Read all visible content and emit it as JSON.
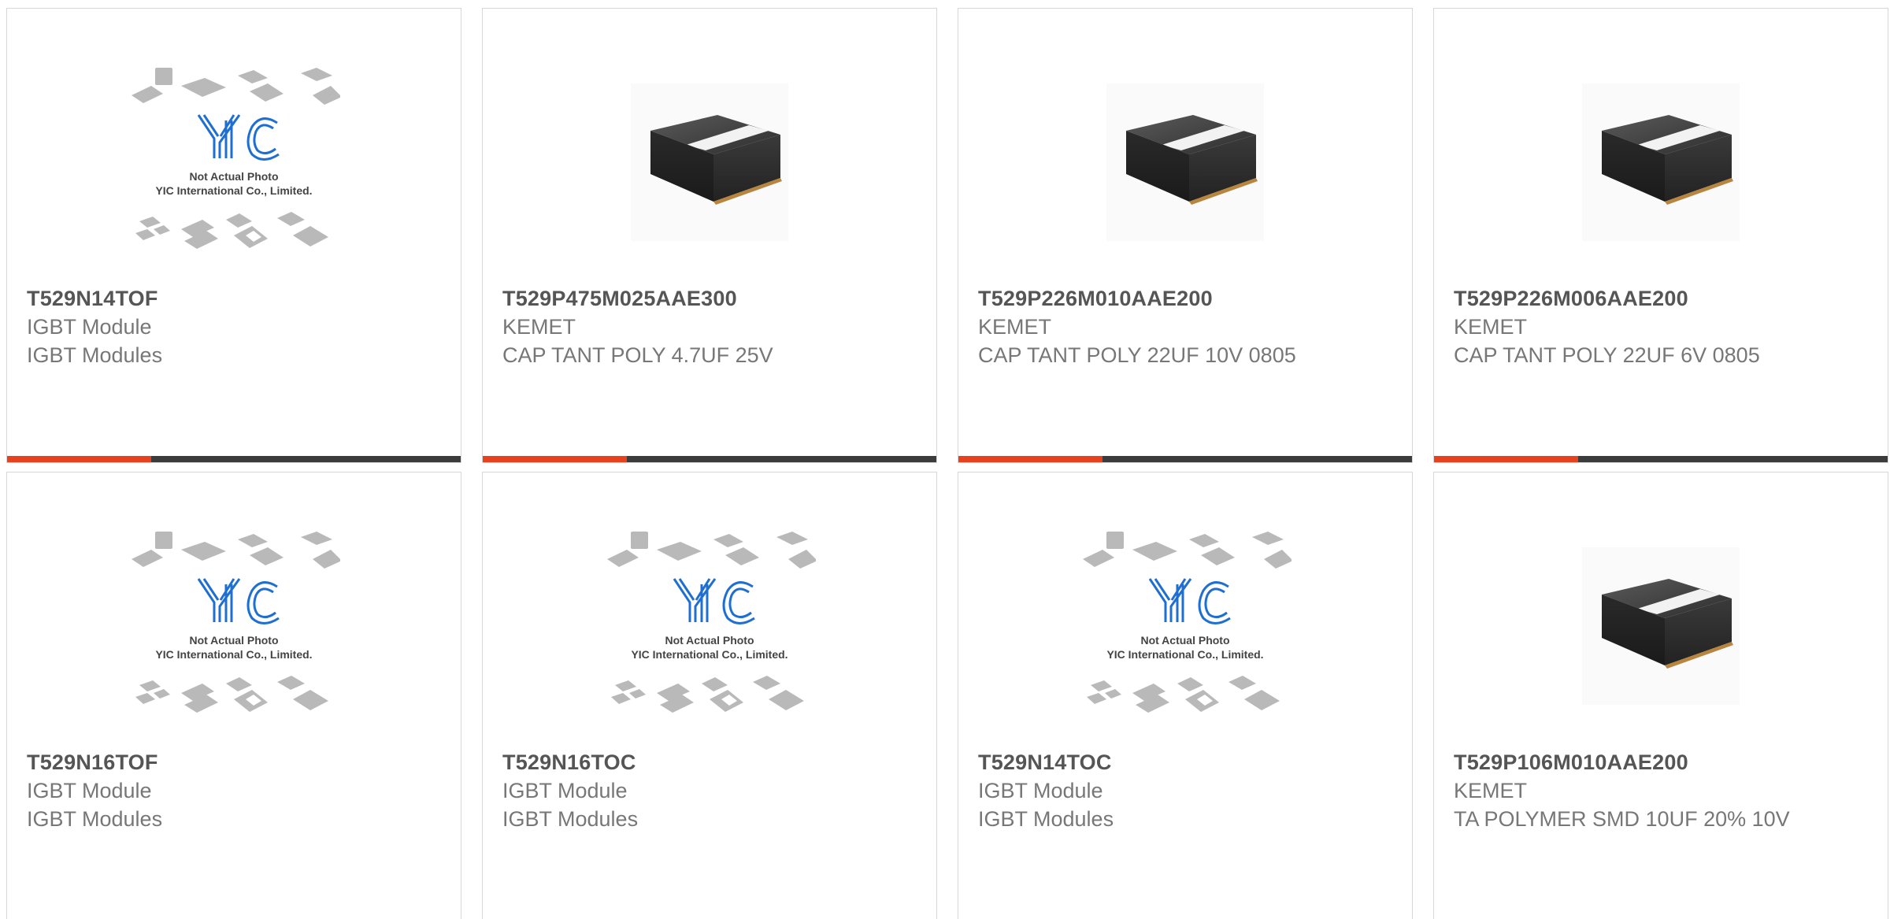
{
  "colors": {
    "accent": "#e8411d",
    "bar_dark": "#3c3c3c",
    "card_border": "#d7d7d7",
    "part_number": "#555555",
    "body_text": "#777777",
    "yic_logo_blue": "#1e6fd1"
  },
  "placeholder": {
    "line1": "Not Actual Photo",
    "line2": "YIC International Co., Limited.",
    "logo_text": "YIC"
  },
  "products": [
    {
      "part_number": "T529N14TOF",
      "manufacturer": "IGBT Module",
      "description": "IGBT Modules",
      "image": "yic-placeholder"
    },
    {
      "part_number": "T529P475M025AAE300",
      "manufacturer": "KEMET",
      "description": "CAP TANT POLY 4.7UF 25V",
      "image": "tantalum-chip"
    },
    {
      "part_number": "T529P226M010AAE200",
      "manufacturer": "KEMET",
      "description": "CAP TANT POLY 22UF 10V 0805",
      "image": "tantalum-chip"
    },
    {
      "part_number": "T529P226M006AAE200",
      "manufacturer": "KEMET",
      "description": "CAP TANT POLY 22UF 6V 0805",
      "image": "tantalum-chip"
    },
    {
      "part_number": "T529N16TOF",
      "manufacturer": "IGBT Module",
      "description": "IGBT Modules",
      "image": "yic-placeholder"
    },
    {
      "part_number": "T529N16TOC",
      "manufacturer": "IGBT Module",
      "description": "IGBT Modules",
      "image": "yic-placeholder"
    },
    {
      "part_number": "T529N14TOC",
      "manufacturer": "IGBT Module",
      "description": "IGBT Modules",
      "image": "yic-placeholder"
    },
    {
      "part_number": "T529P106M010AAE200",
      "manufacturer": "KEMET",
      "description": "TA POLYMER SMD 10UF 20% 10V",
      "image": "tantalum-chip"
    }
  ]
}
